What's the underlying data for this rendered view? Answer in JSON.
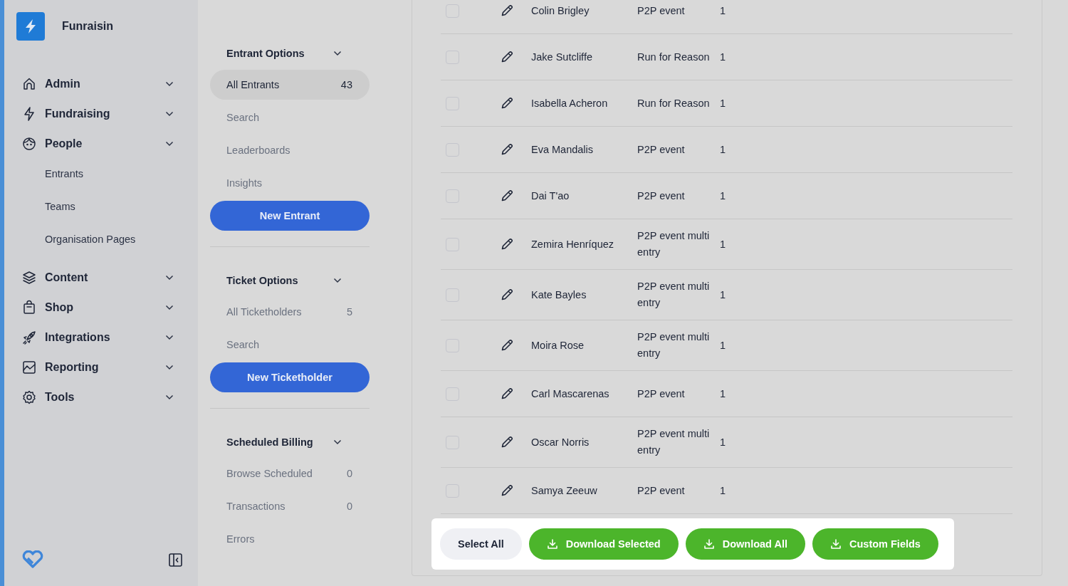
{
  "sidebar": {
    "brand": "Funraisin",
    "nav": [
      {
        "label": "Admin"
      },
      {
        "label": "Fundraising"
      },
      {
        "label": "People",
        "children": [
          {
            "label": "Entrants"
          },
          {
            "label": "Teams"
          },
          {
            "label": "Organisation Pages"
          }
        ]
      },
      {
        "label": "Content"
      },
      {
        "label": "Shop"
      },
      {
        "label": "Integrations"
      },
      {
        "label": "Reporting"
      },
      {
        "label": "Tools"
      }
    ]
  },
  "options_panel": {
    "sections": [
      {
        "title": "Entrant Options",
        "items": [
          {
            "label": "All Entrants",
            "count": "43",
            "selected": true
          },
          {
            "label": "Search",
            "selected": false
          },
          {
            "label": "Leaderboards",
            "selected": false
          },
          {
            "label": "Insights",
            "selected": false
          }
        ],
        "button": "New Entrant"
      },
      {
        "title": "Ticket Options",
        "items": [
          {
            "label": "All Ticketholders",
            "count": "5",
            "selected": false
          },
          {
            "label": "Search",
            "selected": false
          }
        ],
        "button": "New Ticketholder"
      },
      {
        "title": "Scheduled Billing",
        "items": [
          {
            "label": "Browse Scheduled",
            "count": "0",
            "selected": false
          },
          {
            "label": "Transactions",
            "count": "0",
            "selected": false
          },
          {
            "label": "Errors",
            "selected": false
          }
        ]
      }
    ]
  },
  "table": {
    "rows": [
      {
        "name": "Colin Brigley",
        "event": "P2P event",
        "count": "1",
        "checked": false
      },
      {
        "name": "Jake Sutcliffe",
        "event": "Run for Reason",
        "count": "1",
        "checked": false
      },
      {
        "name": "Isabella Acheron",
        "event": "Run for Reason",
        "count": "1",
        "checked": false
      },
      {
        "name": "Eva Mandalis",
        "event": "P2P event",
        "count": "1",
        "checked": false
      },
      {
        "name": "Dai T'ao",
        "event": "P2P event",
        "count": "1",
        "checked": false
      },
      {
        "name": "Zemira Henríquez",
        "event": "P2P event multi entry",
        "count": "1",
        "checked": false
      },
      {
        "name": "Kate Bayles",
        "event": "P2P event multi entry",
        "count": "1",
        "checked": false
      },
      {
        "name": "Moira Rose",
        "event": "P2P event multi entry",
        "count": "1",
        "checked": false
      },
      {
        "name": "Carl Mascarenas",
        "event": "P2P event",
        "count": "1",
        "checked": false
      },
      {
        "name": "Oscar Norris",
        "event": "P2P event multi entry",
        "count": "1",
        "checked": false
      },
      {
        "name": "Samya Zeeuw",
        "event": "P2P event",
        "count": "1",
        "checked": false
      }
    ]
  },
  "action_bar": {
    "buttons": [
      {
        "label": "Select All",
        "kind": "secondary"
      },
      {
        "label": "Download Selected",
        "kind": "download"
      },
      {
        "label": "Download All",
        "kind": "download"
      },
      {
        "label": "Custom Fields",
        "kind": "download"
      }
    ]
  }
}
